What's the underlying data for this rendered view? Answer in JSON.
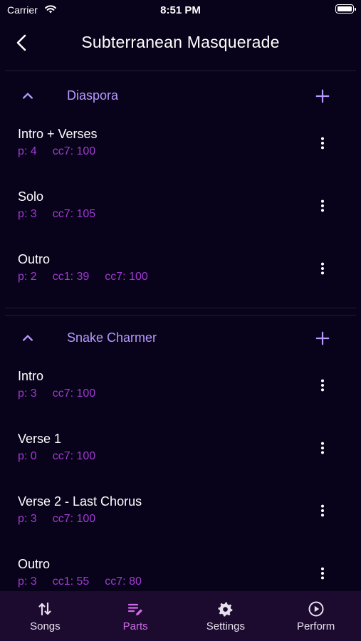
{
  "status_bar": {
    "carrier": "Carrier",
    "time": "8:51 PM"
  },
  "header": {
    "title": "Subterranean Masquerade"
  },
  "songs": [
    {
      "title": "Diaspora",
      "parts": [
        {
          "name": "Intro + Verses",
          "meta": [
            "p: 4",
            "cc7: 100"
          ]
        },
        {
          "name": "Solo",
          "meta": [
            "p: 3",
            "cc7: 105"
          ]
        },
        {
          "name": "Outro",
          "meta": [
            "p: 2",
            "cc1: 39",
            "cc7: 100"
          ]
        }
      ]
    },
    {
      "title": "Snake Charmer",
      "parts": [
        {
          "name": "Intro",
          "meta": [
            "p: 3",
            "cc7: 100"
          ]
        },
        {
          "name": "Verse 1",
          "meta": [
            "p: 0",
            "cc7: 100"
          ]
        },
        {
          "name": "Verse 2 - Last Chorus",
          "meta": [
            "p: 3",
            "cc7: 100"
          ]
        },
        {
          "name": "Outro",
          "meta": [
            "p: 3",
            "cc1: 55",
            "cc7: 80"
          ]
        }
      ]
    }
  ],
  "bottom_nav": [
    {
      "label": "Songs",
      "icon": "sort-arrows-icon",
      "active": false
    },
    {
      "label": "Parts",
      "icon": "edit-list-icon",
      "active": true
    },
    {
      "label": "Settings",
      "icon": "gear-icon",
      "active": false
    },
    {
      "label": "Perform",
      "icon": "play-circle-icon",
      "active": false
    }
  ],
  "colors": {
    "background": "#08031a",
    "accent": "#b699ff",
    "meta": "#a03bd1",
    "nav_bg": "#1c0b2f",
    "nav_active": "#d06ae8"
  }
}
